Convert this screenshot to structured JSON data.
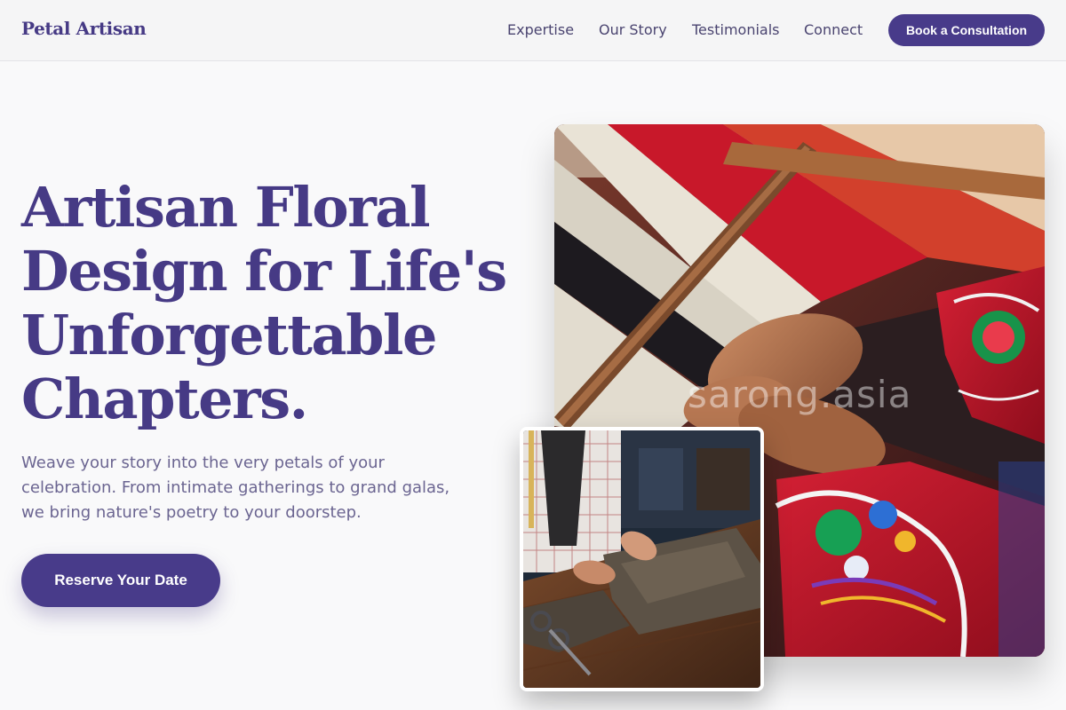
{
  "brand": {
    "logo_text": "Petal Artisan"
  },
  "nav": {
    "items": [
      {
        "label": "Expertise"
      },
      {
        "label": "Our Story"
      },
      {
        "label": "Testimonials"
      },
      {
        "label": "Connect"
      }
    ],
    "cta_label": "Book a Consultation"
  },
  "hero": {
    "title": "Artisan Floral Design for Life's Unforgettable Chapters.",
    "subtitle": "Weave your story into the very petals of your celebration. From intimate gatherings to grand galas, we bring nature's poetry to your doorstep.",
    "cta_label": "Reserve Your Date"
  },
  "images": {
    "main_alt": "Hands weaving colorful threads on a loom",
    "main_watermark": "sarong.asia",
    "secondary_alt": "Tailor cutting fabric on a wooden table"
  },
  "colors": {
    "accent": "#483b8a",
    "title": "#463a85",
    "body_text": "#6b6591",
    "background": "#f9f9fa"
  }
}
